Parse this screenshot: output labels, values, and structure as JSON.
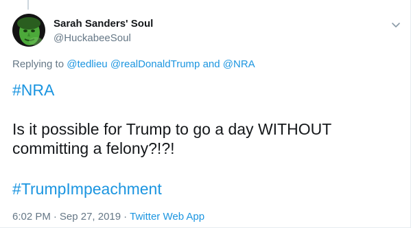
{
  "tweet": {
    "display_name": "Sarah Sanders' Soul",
    "handle": "@HuckabeeSoul",
    "replying_prefix": "Replying to",
    "reply_mentions": [
      "@tedlieu",
      "@realDonaldTrump",
      "@NRA"
    ],
    "reply_conjunction": "and",
    "hashtag_top": "#NRA",
    "body_line1": "Is it possible for Trump to go a day WITHOUT",
    "body_line2": "committing a felony?!?!",
    "hashtag_bottom": "#TrumpImpeachment",
    "time": "6:02 PM",
    "separator": "·",
    "date": "Sep 27, 2019",
    "source": "Twitter Web App"
  },
  "icons": {
    "avatar": "avatar-green-face",
    "more": "chevron-down-icon"
  },
  "colors": {
    "link": "#1b95e0",
    "secondary_text": "#657786",
    "primary_text": "#14171a",
    "border": "#e6ecf0"
  }
}
